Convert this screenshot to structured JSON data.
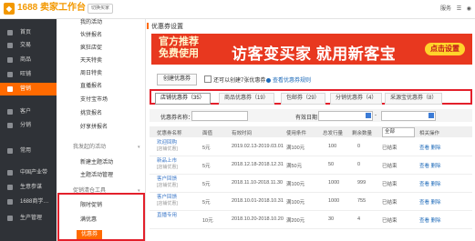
{
  "app": {
    "logo_badge": "◆",
    "logo_text": "1688 卖家工作台",
    "switch_label": "切换买家"
  },
  "top_right": {
    "items": [
      "服务",
      "☰",
      "◉"
    ]
  },
  "left_nav": [
    {
      "label": "首页",
      "icon": "home-icon"
    },
    {
      "label": "交易",
      "icon": "trade-icon"
    },
    {
      "label": "商品",
      "icon": "goods-icon"
    },
    {
      "label": "旺铺",
      "icon": "shop-icon"
    },
    {
      "label": "营销",
      "icon": "marketing-icon",
      "active": true
    },
    {
      "label": "客户",
      "icon": "customer-icon"
    },
    {
      "label": "分销",
      "icon": "distribution-icon"
    },
    {
      "label": "常用",
      "icon": "star-icon"
    },
    {
      "label": "中国产业带",
      "icon": "industry-icon"
    },
    {
      "label": "生意参谋",
      "icon": "advisor-icon"
    },
    {
      "label": "1688商学…",
      "icon": "school-icon"
    },
    {
      "label": "生产管理",
      "icon": "production-icon"
    }
  ],
  "sub_nav": [
    {
      "label": "我的活动"
    },
    {
      "label": "伙拼报名"
    },
    {
      "label": "疯狂店促"
    },
    {
      "label": "天天特卖"
    },
    {
      "label": "周日特卖"
    },
    {
      "label": "直播报名"
    },
    {
      "label": "支付宝市场"
    },
    {
      "label": "挑货报名"
    },
    {
      "label": "好享拼报名"
    },
    {
      "label": "我发起的活动",
      "group": true
    },
    {
      "label": "新建主题活动"
    },
    {
      "label": "主题活动管理"
    },
    {
      "label": "促销清仓工具",
      "group": true
    },
    {
      "label": "限时促销"
    },
    {
      "label": "满优惠"
    },
    {
      "label": "优惠券",
      "active": true
    }
  ],
  "page": {
    "title": "优惠券设置"
  },
  "banner": {
    "left_line1": "官方推荐",
    "left_line2": "免费使用",
    "main": "访客变买家 就用新客宝",
    "button": "点击设置"
  },
  "toolbar": {
    "create": "创建优惠券",
    "check_all": "还可以创建7张优惠券",
    "view_rules": "查看优惠券规则"
  },
  "tabs": [
    {
      "label": "店铺优惠券（35）",
      "active": true
    },
    {
      "label": "商品优惠券（19）"
    },
    {
      "label": "包邮券（29）"
    },
    {
      "label": "分销优惠券（4）"
    },
    {
      "label": "采源宝优惠券（8）"
    }
  ],
  "filter": {
    "name_label": "优惠券名称：",
    "date_label": "有效日期：",
    "date_sep": "-"
  },
  "table": {
    "headers": [
      "优惠券名称",
      "面值",
      "有效时间",
      "使用条件",
      "总发行量",
      "剩余数量",
      "",
      "相关操作"
    ],
    "status_select": "全部",
    "rows": [
      {
        "name": "欢迎回购",
        "tag": "[店铺优惠]",
        "value": "5元",
        "time": "2019.02.13-2019.03.01",
        "condition": "满100元",
        "total": "100",
        "remain": "0",
        "status": "已结束",
        "ops": "查看 删除"
      },
      {
        "name": "新品上市",
        "tag": "[店铺优惠]",
        "value": "5元",
        "time": "2018.12.18-2018.12.31",
        "condition": "满50元",
        "total": "50",
        "remain": "0",
        "status": "已结束",
        "ops": "查看 删除"
      },
      {
        "name": "客户回馈",
        "tag": "[店铺优惠]",
        "value": "5元",
        "time": "2018.11.10-2018.11.30",
        "condition": "满100元",
        "total": "1000",
        "remain": "999",
        "status": "已结束",
        "ops": "查看 删除"
      },
      {
        "name": "客户回馈",
        "tag": "[店铺优惠]",
        "value": "5元",
        "time": "2018.10.01-2018.10.31",
        "condition": "满100元",
        "total": "1000",
        "remain": "755",
        "status": "已结束",
        "ops": "查看 删除"
      },
      {
        "name": "直播专用",
        "tag": "",
        "value": "10元",
        "time": "2018.10.20-2018.10.20",
        "condition": "满200元",
        "total": "30",
        "remain": "4",
        "status": "已结束",
        "ops": "查看 删除"
      }
    ]
  },
  "colors": {
    "accent": "#ff6a00",
    "nav_bg": "#2f3237",
    "highlight": "#e3202b",
    "link": "#1d6ab9"
  }
}
